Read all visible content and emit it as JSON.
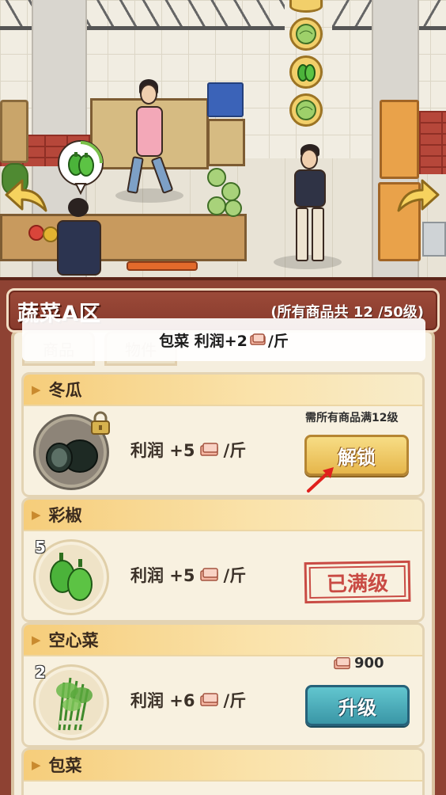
{
  "toast": {
    "prefix": "包菜 利润+2",
    "suffix": "/斤"
  },
  "zone": {
    "title": "蔬菜A区",
    "summary": "(所有商品共 12 /50级)"
  },
  "tabs": [
    {
      "label": "商品"
    },
    {
      "label": "物件"
    }
  ],
  "items": [
    {
      "name": "冬瓜",
      "profit_prefix": "利润  +5",
      "profit_suffix": "/斤",
      "requirement": "需所有商品满12级",
      "action_label": "解锁",
      "locked": true
    },
    {
      "name": "彩椒",
      "level": "5",
      "profit_prefix": "利润  +5",
      "profit_suffix": "/斤",
      "status_label": "已满级"
    },
    {
      "name": "空心菜",
      "level": "2",
      "profit_prefix": "利润  +6",
      "profit_suffix": "/斤",
      "cost": "900",
      "action_label": "升级"
    },
    {
      "name": "包菜"
    }
  ],
  "colors": {
    "panel_bg": "#8e4233",
    "unlock_button": "#e6b64b",
    "upgrade_button": "#3a96a6",
    "maxed_stamp": "#c43a34"
  },
  "icons": {
    "currency": "cash-bill-icon",
    "lock": "lock-icon",
    "nav_left": "back-arrow-icon",
    "nav_right": "forward-arrow-icon"
  }
}
